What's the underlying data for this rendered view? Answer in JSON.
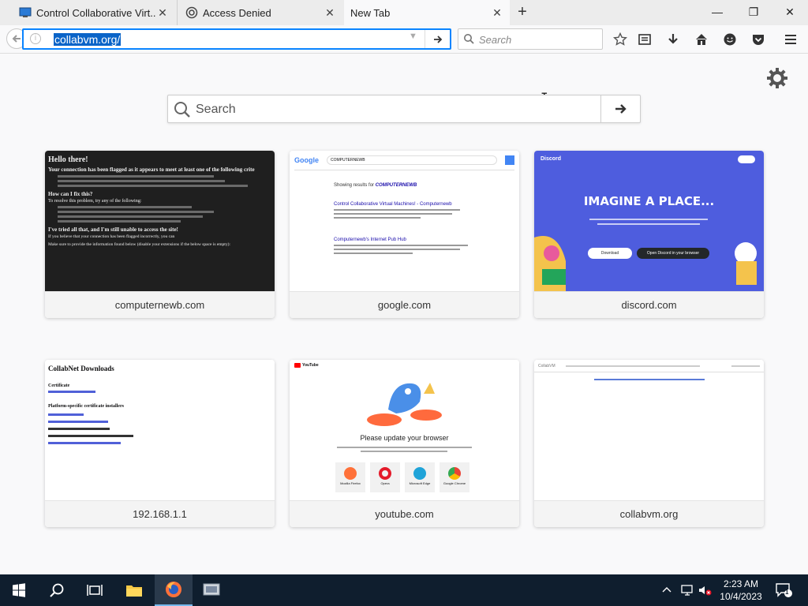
{
  "tabs": [
    {
      "title": "Control Collaborative Virt...",
      "close": "✕"
    },
    {
      "title": "Access Denied",
      "close": "✕"
    },
    {
      "title": "New Tab",
      "close": "✕",
      "active": true
    }
  ],
  "new_tab_symbol": "+",
  "window_controls": {
    "minimize": "—",
    "restore": "❐",
    "close": "✕"
  },
  "navbar": {
    "url": "collabvm.org/",
    "search_placeholder": "Search"
  },
  "newtab": {
    "search_placeholder": "Search",
    "tiles": [
      {
        "label": "computernewb.com"
      },
      {
        "label": "google.com"
      },
      {
        "label": "discord.com"
      },
      {
        "label": "192.168.1.1"
      },
      {
        "label": "youtube.com"
      },
      {
        "label": "collabvm.org"
      }
    ]
  },
  "thumbs": {
    "computernewb": {
      "heading1": "Hello there!",
      "line1": "Your connection has been flagged as it appears to meet at least one of the following crite",
      "heading2": "How can I fix this?",
      "line2": "To resolve this problem, try any of the following:",
      "heading3": "I've tried all that, and I'm still unable to access the site!",
      "line3": "If you believe that your connection has been flagged incorrectly, you can",
      "line4": "Make sure to provide the information found below (disable your extensions if the below space is empty):"
    },
    "google": {
      "logo": "Google",
      "query": "COMPUTERNEWB",
      "results_for": "Showing results for",
      "results_term": "COMPUTERNEWB",
      "result1": "Control Collaborative Virtual Machines! - Computernewb",
      "result2": "Computernewb's Internet Pub Hub"
    },
    "discord": {
      "brand": "Discord",
      "headline": "IMAGINE A PLACE...",
      "download": "Download",
      "open": "Open Discord in your browser"
    },
    "collabnet": {
      "heading": "CollabNet Downloads",
      "certificate": "Certificate",
      "installers": "Platform-specific certificate installers"
    },
    "youtube": {
      "brand": "YouTube",
      "title": "Please update your browser",
      "browsers": [
        "Mozilla Firefox",
        "Opera",
        "Microsoft Edge",
        "Google Chrome"
      ]
    },
    "collabvm": {
      "brand": "CollabVM"
    }
  },
  "taskbar": {
    "time": "2:23 AM",
    "date": "10/4/2023",
    "notification_count": "1"
  },
  "colors": {
    "accent": "#0a84ff",
    "discord": "#4e5dde",
    "taskbar": "#0f1e2e"
  }
}
